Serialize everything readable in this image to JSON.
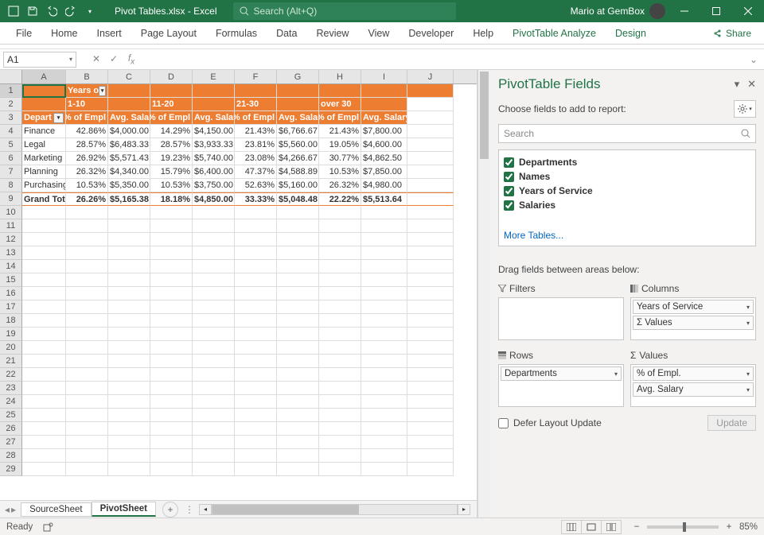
{
  "titlebar": {
    "docname": "Pivot Tables.xlsx  -  Excel",
    "search_placeholder": "Search (Alt+Q)",
    "user": "Mario at GemBox"
  },
  "ribbon": {
    "tabs": [
      "File",
      "Home",
      "Insert",
      "Page Layout",
      "Formulas",
      "Data",
      "Review",
      "View",
      "Developer",
      "Help",
      "PivotTable Analyze",
      "Design"
    ],
    "share": "Share"
  },
  "namebox": "A1",
  "columns": [
    "A",
    "B",
    "C",
    "D",
    "E",
    "F",
    "G",
    "H",
    "I",
    "J"
  ],
  "row_count": 29,
  "pivot": {
    "col_field_label": "Years of Service",
    "col_groups": [
      "1-10",
      "11-20",
      "21-30",
      "over 30"
    ],
    "row_field_label": "Departments",
    "measure_headers": [
      "% of Empl",
      "Avg. Salary"
    ],
    "rows": [
      {
        "label": "Finance",
        "v": [
          "42.86%",
          "$4,000.00",
          "14.29%",
          "$4,150.00",
          "21.43%",
          "$6,766.67",
          "21.43%",
          "$7,800.00"
        ]
      },
      {
        "label": "Legal",
        "v": [
          "28.57%",
          "$6,483.33",
          "28.57%",
          "$3,933.33",
          "23.81%",
          "$5,560.00",
          "19.05%",
          "$4,600.00"
        ]
      },
      {
        "label": "Marketing",
        "v": [
          "26.92%",
          "$5,571.43",
          "19.23%",
          "$5,740.00",
          "23.08%",
          "$4,266.67",
          "30.77%",
          "$4,862.50"
        ]
      },
      {
        "label": "Planning",
        "v": [
          "26.32%",
          "$4,340.00",
          "15.79%",
          "$6,400.00",
          "47.37%",
          "$4,588.89",
          "10.53%",
          "$7,850.00"
        ]
      },
      {
        "label": "Purchasing",
        "v": [
          "10.53%",
          "$5,350.00",
          "10.53%",
          "$3,750.00",
          "52.63%",
          "$5,160.00",
          "26.32%",
          "$4,980.00"
        ]
      }
    ],
    "grand": {
      "label": "Grand Total",
      "v": [
        "26.26%",
        "$5,165.38",
        "18.18%",
        "$4,850.00",
        "33.33%",
        "$5,048.48",
        "22.22%",
        "$5,513.64"
      ]
    }
  },
  "sheets": {
    "tabs": [
      "SourceSheet",
      "PivotSheet"
    ],
    "active": 1,
    "add_tooltip": "+"
  },
  "status": {
    "ready": "Ready",
    "zoom": "85%"
  },
  "fields": {
    "title": "PivotTable Fields",
    "subtitle": "Choose fields to add to report:",
    "search_placeholder": "Search",
    "list": [
      "Departments",
      "Names",
      "Years of Service",
      "Salaries"
    ],
    "more": "More Tables...",
    "dragtxt": "Drag fields between areas below:",
    "areas": {
      "filters": {
        "label": "Filters",
        "items": []
      },
      "columns": {
        "label": "Columns",
        "items": [
          "Years of Service",
          "Σ  Values"
        ]
      },
      "rows": {
        "label": "Rows",
        "items": [
          "Departments"
        ]
      },
      "values": {
        "label": "Values",
        "sigma": "Σ",
        "items": [
          "% of Empl.",
          "Avg. Salary"
        ]
      }
    },
    "defer": "Defer Layout Update",
    "update": "Update"
  }
}
